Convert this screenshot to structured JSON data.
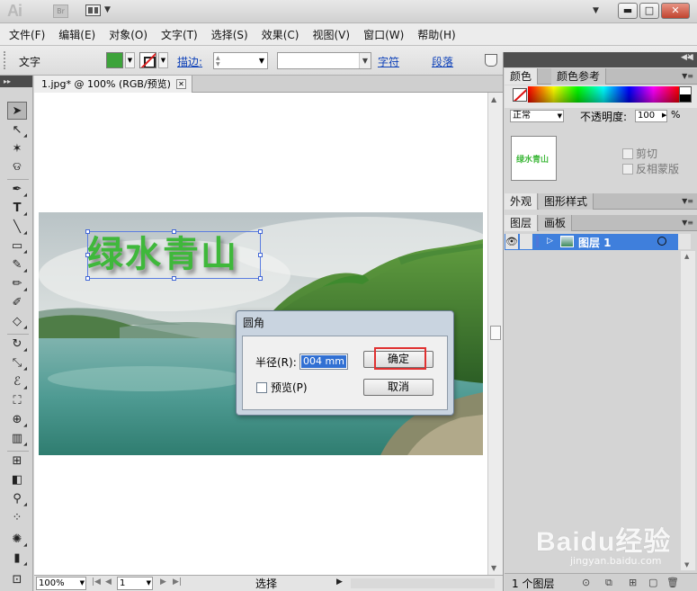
{
  "app": {
    "logo": "Ai",
    "bridge_logo": "Br"
  },
  "menus": [
    "文件(F)",
    "编辑(E)",
    "对象(O)",
    "文字(T)",
    "选择(S)",
    "效果(C)",
    "视图(V)",
    "窗口(W)",
    "帮助(H)"
  ],
  "control_bar": {
    "tool_label": "文字",
    "fill_color": "#3da33a",
    "stroke_label": "描边:",
    "char_label": "字符",
    "para_label": "段落"
  },
  "document": {
    "tab_title": "1.jpg* @ 100% (RGB/预览)",
    "headline": "绿水青山"
  },
  "dialog": {
    "title": "圆角",
    "radius_label": "半径(R):",
    "radius_value": "004 mm",
    "preview_label": "预览(P)",
    "ok_label": "确定",
    "cancel_label": "取消"
  },
  "status_bar": {
    "zoom": "100%",
    "page": "1",
    "status_text": "选择"
  },
  "color_panel": {
    "tabs": [
      "颜色",
      "颜色参考"
    ]
  },
  "transparency_panel": {
    "blend_mode": "正常",
    "opacity_label": "不透明度:",
    "opacity_value": "100",
    "percent": "%",
    "thumb_text": "绿水青山",
    "clip_label": "剪切",
    "invert_mask_label": "反相蒙版"
  },
  "appearance_panel": {
    "tabs": [
      "外观",
      "图形样式"
    ]
  },
  "layers_panel": {
    "tabs": [
      "图层",
      "画板"
    ],
    "layer_name": "图层 1",
    "layer_count": "1 个图层",
    "highlight_color": "#3f7fdc"
  },
  "watermark": {
    "brand": "Baidu经验",
    "url": "jingyan.baidu.com"
  }
}
